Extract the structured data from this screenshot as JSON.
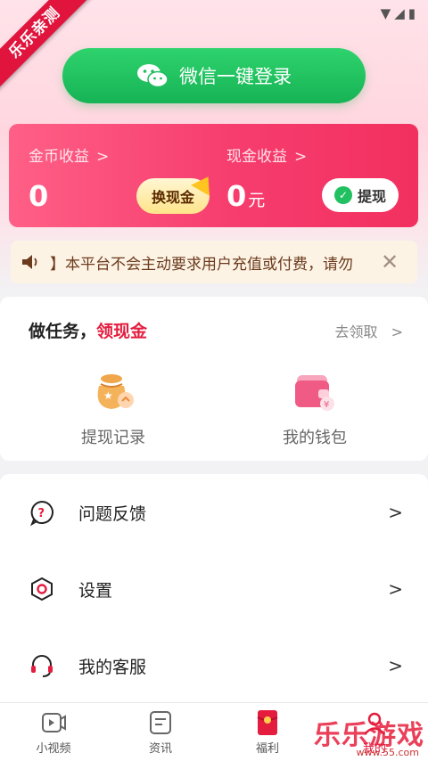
{
  "status": {
    "icons": [
      "wifi-icon",
      "signal-icon",
      "battery-icon"
    ]
  },
  "ribbon": {
    "text": "乐乐亲测"
  },
  "login": {
    "label": "微信一键登录"
  },
  "earnings": {
    "coin_label": "金币收益",
    "coin_value": "0",
    "cash_label": "现金收益",
    "cash_value": "0",
    "cash_unit": "元",
    "exchange_label": "换现金",
    "withdraw_label": "提现",
    "chevron": ">"
  },
  "notice": {
    "text": "】本平台不会主动要求用户充值或付费，请勿"
  },
  "task": {
    "title_a": "做任务，",
    "title_b": "领现金",
    "go_label": "去领取",
    "items": [
      {
        "label": "提现记录",
        "icon": "money-bag-icon"
      },
      {
        "label": "我的钱包",
        "icon": "wallet-icon"
      }
    ]
  },
  "menu": {
    "items": [
      {
        "label": "问题反馈",
        "icon": "feedback-icon"
      },
      {
        "label": "设置",
        "icon": "settings-icon"
      },
      {
        "label": "我的客服",
        "icon": "headset-icon"
      }
    ]
  },
  "tabbar": {
    "items": [
      {
        "label": "小视频"
      },
      {
        "label": "资讯"
      },
      {
        "label": "福利"
      },
      {
        "label": "我的"
      }
    ]
  },
  "watermark": {
    "text": "乐乐游戏",
    "sub": "www.55.com"
  },
  "colors": {
    "brand_red": "#e41d3f",
    "wechat_green": "#17b355",
    "card_pink": "#f63d6e"
  }
}
